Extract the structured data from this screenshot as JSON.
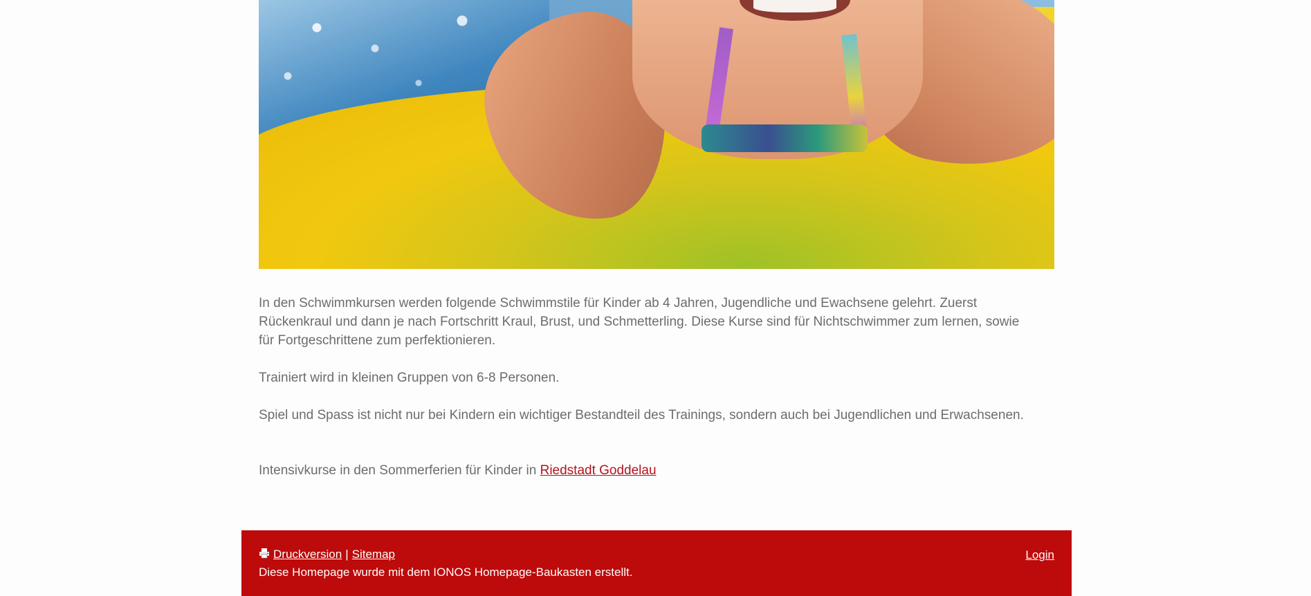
{
  "main": {
    "hero_image_alt": "",
    "paragraphs": [
      "In den Schwimmkursen werden folgende Schwimmstile für Kinder ab 4 Jahren, Jugendliche und Ewachsene gelehrt. Zuerst Rückenkraul und dann je nach Fortschritt Kraul, Brust, und Schmetterling. Diese Kurse sind für Nichtschwimmer zum lernen, sowie für Fortgeschrittene zum perfektionieren.",
      "Trainiert wird in kleinen Gruppen von 6-8 Personen.",
      "Spiel und Spass ist nicht nur bei Kindern ein wichtiger Bestandteil des Trainings, sondern auch bei Jugendlichen und Erwachsenen."
    ],
    "intensive": {
      "text": "Intensivkurse in den Sommerferien für Kinder in ",
      "link_label": "Riedstadt Goddelau"
    }
  },
  "footer": {
    "print_label": "Druckversion",
    "separator": "|",
    "sitemap_label": "Sitemap",
    "credit": "Diese Homepage wurde mit dem IONOS Homepage-Baukasten erstellt.",
    "login_label": "Login"
  },
  "colors": {
    "footer_bg": "#bd0a0a",
    "link": "#b5121b",
    "text": "#6c6c6c"
  },
  "icons": {
    "print": "printer-icon"
  }
}
